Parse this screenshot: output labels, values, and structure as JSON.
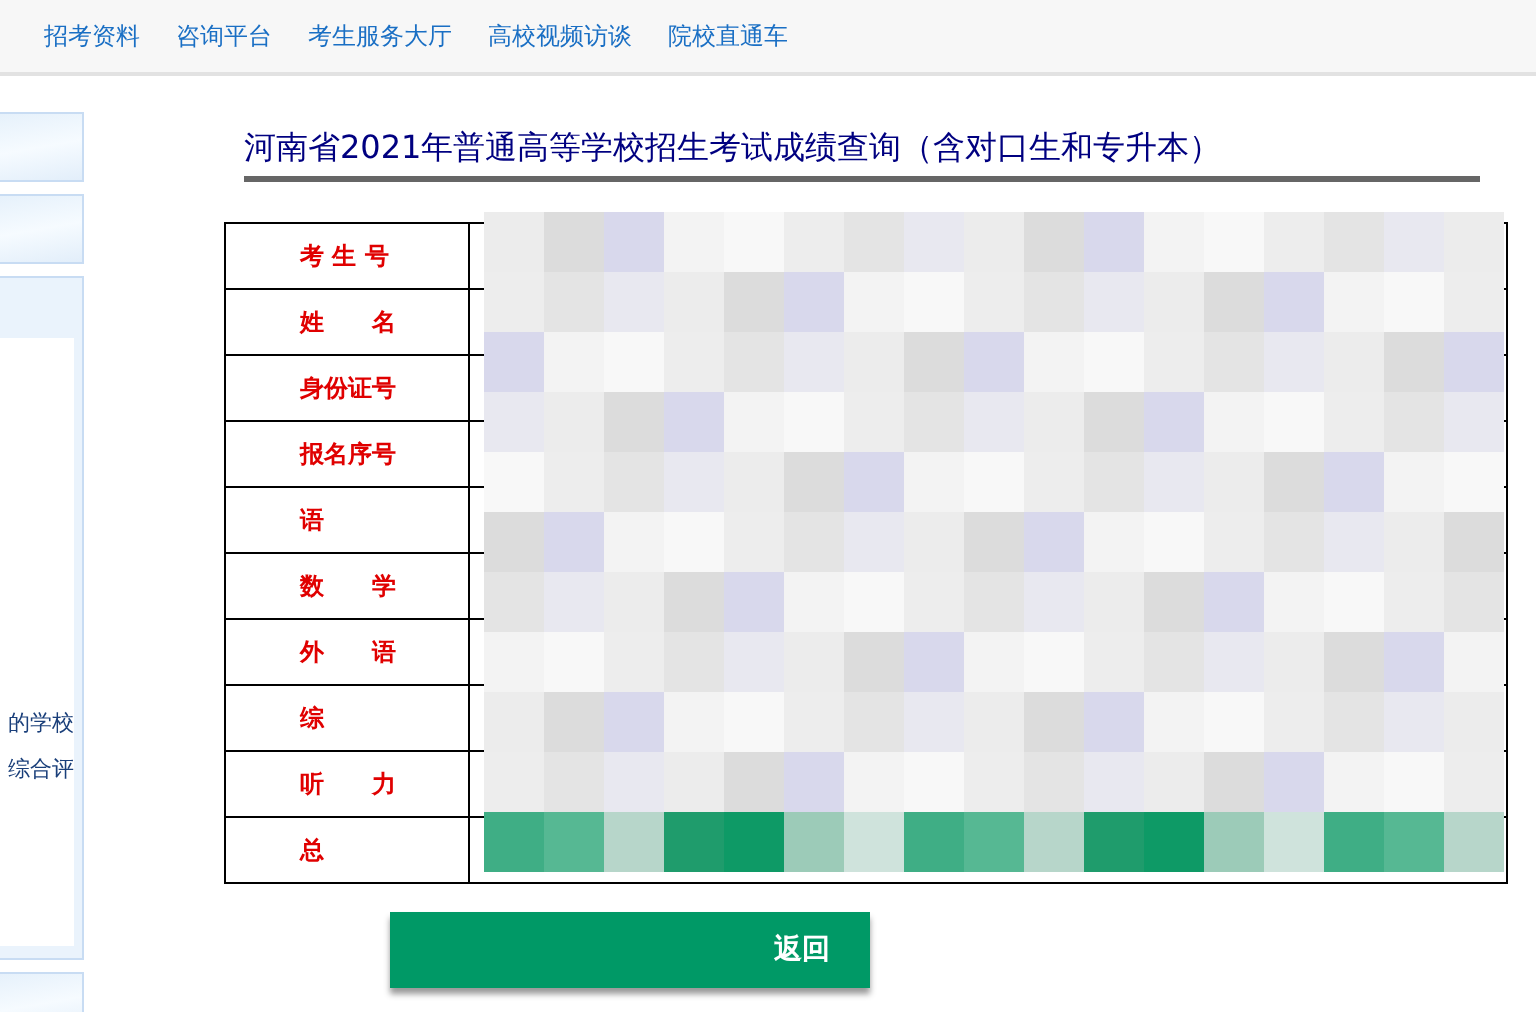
{
  "nav": {
    "items": [
      "招考资料",
      "咨询平台",
      "考生服务大厅",
      "高校视频访谈",
      "院校直通车"
    ]
  },
  "sidebar": {
    "lines": [
      "的学校",
      "综合评"
    ]
  },
  "title": "河南省2021年普通高等学校招生考试成绩查询（含对口生和专升本）",
  "table": {
    "rows": [
      {
        "label": "考 生 号"
      },
      {
        "label": "姓　　名"
      },
      {
        "label": "身份证号"
      },
      {
        "label": "报名序号"
      },
      {
        "label": "语"
      },
      {
        "label": "数　　学"
      },
      {
        "label": "外　　语"
      },
      {
        "label": "综"
      },
      {
        "label": "听　　力"
      },
      {
        "label": "总"
      }
    ]
  },
  "button": "返回"
}
